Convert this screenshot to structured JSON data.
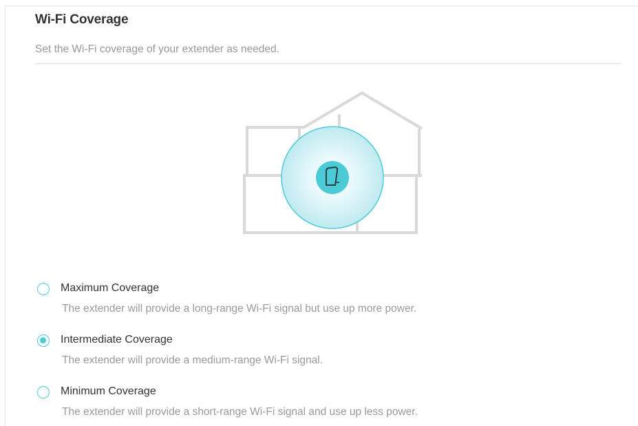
{
  "section": {
    "title": "Wi-Fi Coverage",
    "subtitle": "Set the Wi-Fi coverage of your extender as needed."
  },
  "illustration": {
    "house_icon": "house-outline-icon",
    "extender_icon": "extender-device-icon",
    "coverage_color": "#4acbd6"
  },
  "options": [
    {
      "label": "Maximum Coverage",
      "description": "The extender will provide a long-range Wi-Fi signal but use up more power.",
      "selected": false
    },
    {
      "label": "Intermediate Coverage",
      "description": "The extender will provide a medium-range Wi-Fi signal.",
      "selected": true
    },
    {
      "label": "Minimum Coverage",
      "description": "The extender will provide a short-range Wi-Fi signal and use up less power.",
      "selected": false
    }
  ],
  "colors": {
    "accent": "#4acbd6",
    "title_text": "#333333",
    "muted_text": "#999999"
  }
}
